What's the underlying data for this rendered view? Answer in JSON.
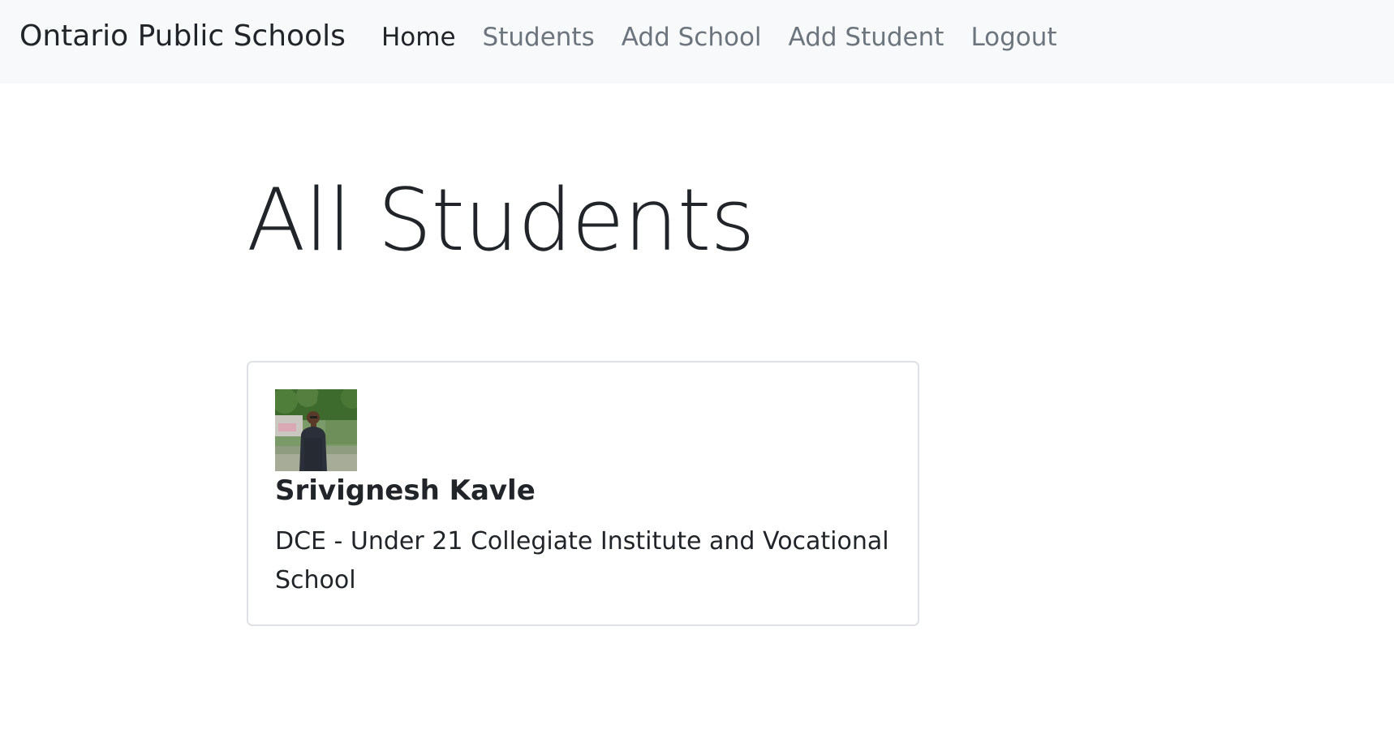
{
  "navbar": {
    "brand": "Ontario Public Schools",
    "links": [
      {
        "label": "Home",
        "active": true
      },
      {
        "label": "Students",
        "active": false
      },
      {
        "label": "Add School",
        "active": false
      },
      {
        "label": "Add Student",
        "active": false
      },
      {
        "label": "Logout",
        "active": false
      }
    ]
  },
  "main": {
    "title": "All Students",
    "students": [
      {
        "name": "Srivignesh Kavle",
        "school": "DCE - Under 21 Collegiate Institute and Vocational School",
        "photo_icon": "student-photo"
      }
    ]
  },
  "colors": {
    "navbar_bg": "#f8f9fa",
    "link_muted": "#6c757d",
    "text": "#212529",
    "card_border": "#dee2e6"
  }
}
